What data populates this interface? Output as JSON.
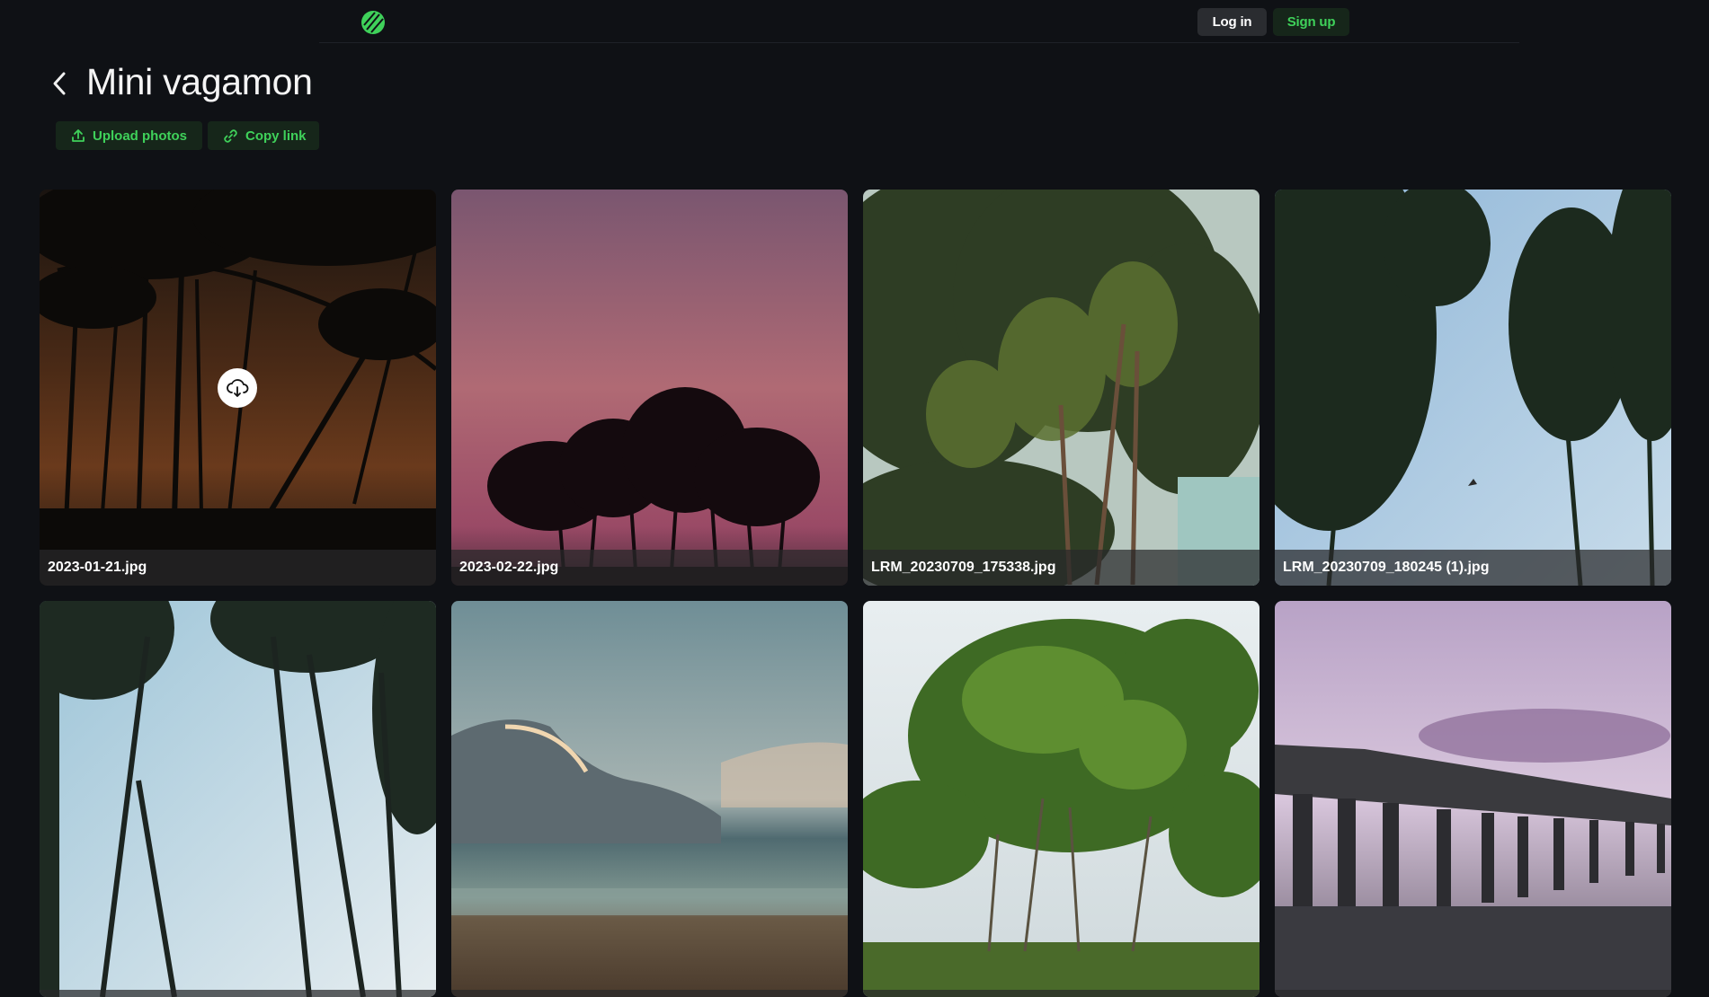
{
  "header": {
    "logo_icon": "brand-logo-icon",
    "login_label": "Log in",
    "signup_label": "Sign up"
  },
  "album": {
    "title": "Mini vagamon",
    "back_icon": "chevron-left-icon",
    "upload_label": "Upload photos",
    "copy_link_label": "Copy link"
  },
  "photos": [
    {
      "filename": "2023-01-21.jpg"
    },
    {
      "filename": "2023-02-22.jpg"
    },
    {
      "filename": "LRM_20230709_175338.jpg"
    },
    {
      "filename": "LRM_20230709_180245 (1).jpg"
    },
    {
      "filename": ""
    },
    {
      "filename": ""
    },
    {
      "filename": ""
    },
    {
      "filename": ""
    }
  ],
  "hover_action_icon": "cloud-download-icon",
  "colors": {
    "background": "#0f1115",
    "accent_green": "#3fd15a",
    "accent_green_bg": "#16261a",
    "login_bg": "#2a2c30"
  }
}
